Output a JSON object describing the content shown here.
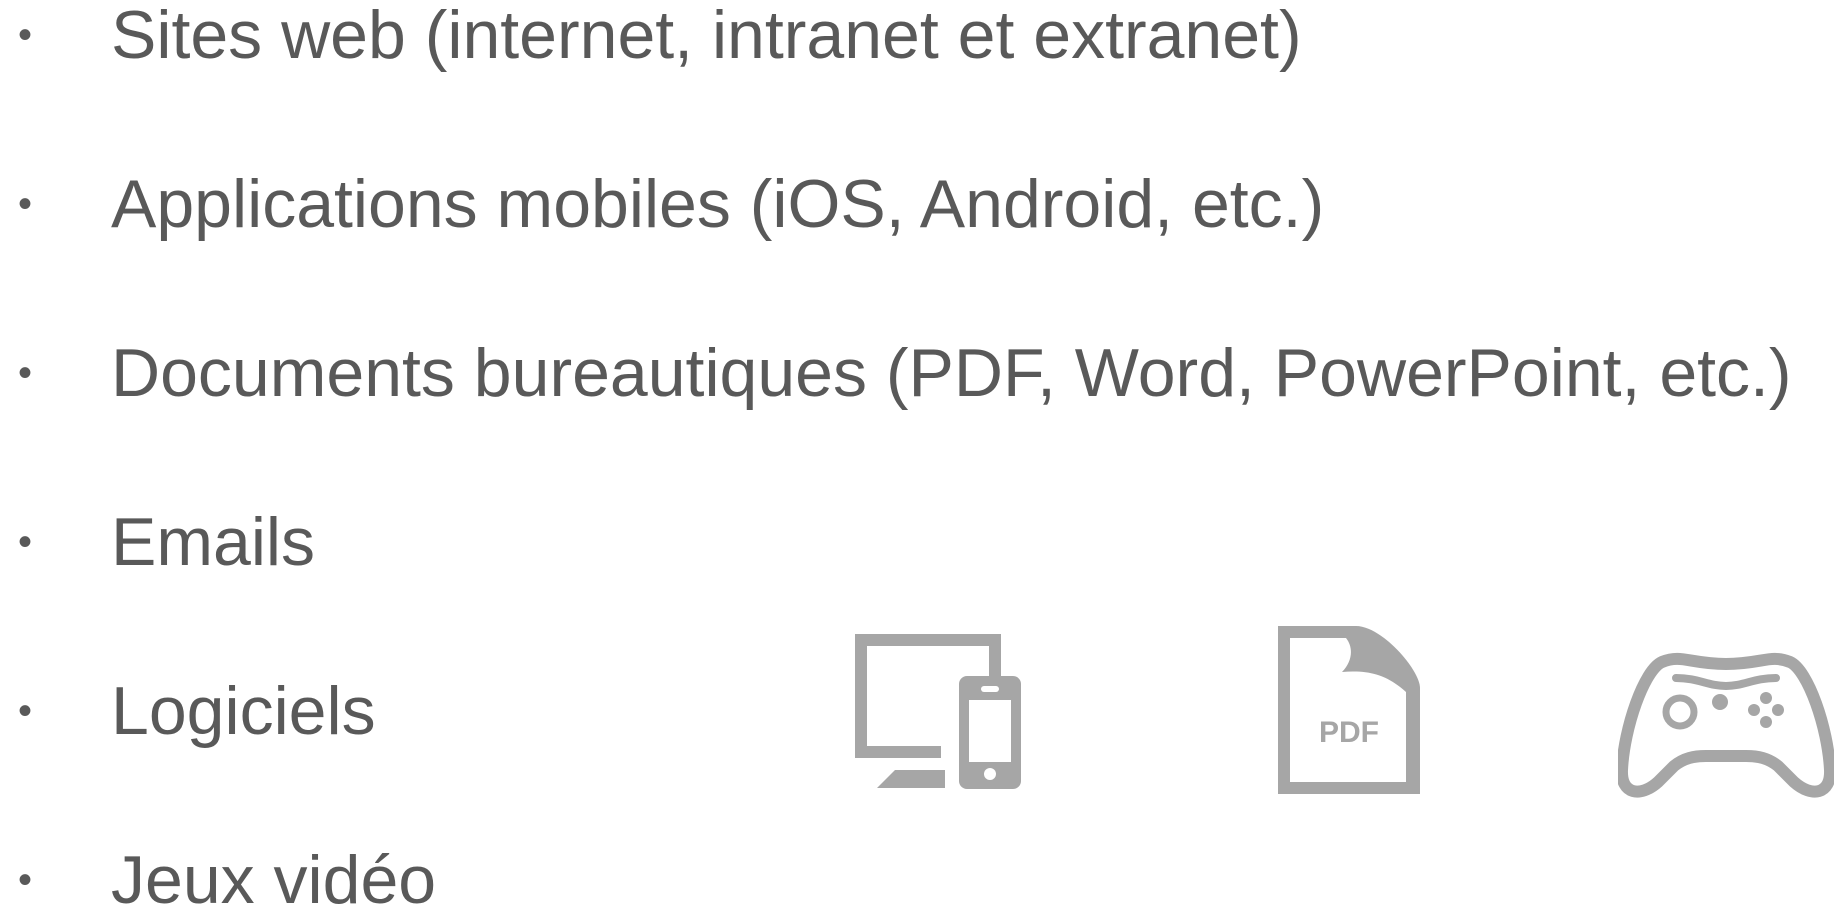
{
  "bullet_items": [
    {
      "label": "Sites web (internet, intranet et extranet)"
    },
    {
      "label": "Applications mobiles (iOS, Android, etc.)"
    },
    {
      "label": "Documents bureautiques (PDF, Word, PowerPoint, etc.)"
    },
    {
      "label": "Emails"
    },
    {
      "label": "Logiciels"
    },
    {
      "label": "Jeux vidéo"
    }
  ],
  "bullet_glyph": "•",
  "icons": {
    "devices": "desktop-and-phone-icon",
    "pdf": "pdf-document-icon",
    "pdf_label": "PDF",
    "gamepad": "game-controller-icon"
  },
  "colors": {
    "text": "#595959",
    "icon": "#a6a6a6",
    "background": "#ffffff"
  }
}
